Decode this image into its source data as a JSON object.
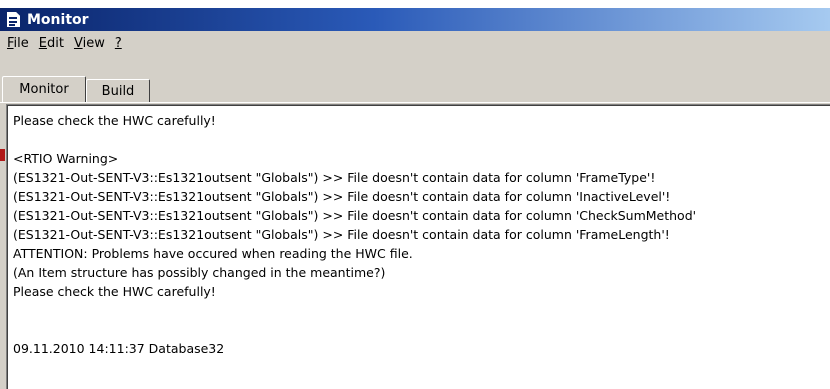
{
  "window": {
    "title": "Monitor"
  },
  "menu": [
    {
      "label": "File",
      "mnemonic": "F",
      "rest": "ile"
    },
    {
      "label": "Edit",
      "mnemonic": "E",
      "rest": "dit"
    },
    {
      "label": "View",
      "mnemonic": "V",
      "rest": "iew"
    },
    {
      "label": "?",
      "mnemonic": "?",
      "rest": ""
    }
  ],
  "tabs": [
    {
      "label": "Monitor",
      "selected": true
    },
    {
      "label": "Build",
      "selected": false
    }
  ],
  "log": {
    "lines": [
      "Please check the HWC carefully!",
      "",
      "<RTIO Warning>",
      "(ES1321-Out-SENT-V3::Es1321outsent \"Globals\") >> File doesn't contain data for column 'FrameType'!",
      "(ES1321-Out-SENT-V3::Es1321outsent \"Globals\") >> File doesn't contain data for column 'InactiveLevel'!",
      "(ES1321-Out-SENT-V3::Es1321outsent \"Globals\") >> File doesn't contain data for column 'CheckSumMethod'",
      "(ES1321-Out-SENT-V3::Es1321outsent \"Globals\") >> File doesn't contain data for column 'FrameLength'!",
      "ATTENTION: Problems have occured when reading the HWC file.",
      "(An Item structure has possibly changed in the meantime?)",
      "Please check the HWC carefully!",
      "",
      "",
      "09.11.2010 14:11:37 Database32"
    ]
  }
}
